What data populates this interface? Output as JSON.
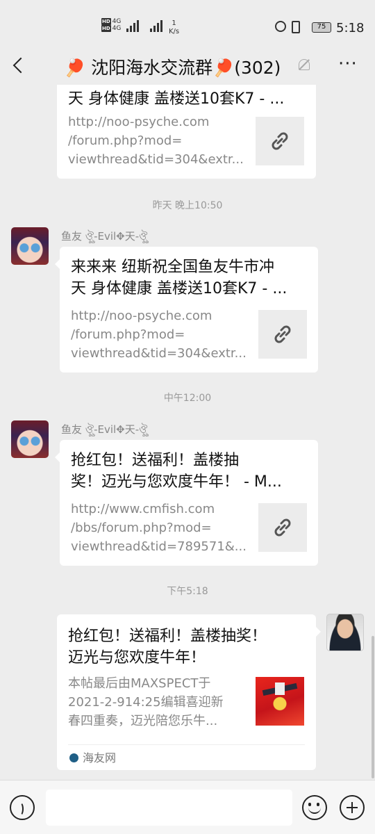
{
  "status_bar": {
    "network_badges": [
      "HD",
      "HD"
    ],
    "network_type": [
      "4G",
      "4G"
    ],
    "speed_value": "1",
    "speed_unit": "K/s",
    "battery": "75",
    "time": "5:18"
  },
  "header": {
    "title": "🏓 沈阳海水交流群🏓(302)",
    "more_label": "···"
  },
  "messages": [
    {
      "title": "天 身体健康 盖楼送10套K7 - ...",
      "url": "http://noo-psyche.com\n/forum.php?mod=\nviewthread&tid=304&extr..."
    },
    {
      "time": "昨天 晚上10:50",
      "sender": "鱼友 ঔৣ-Evil✥天-ঔৣ",
      "title": "来来来 纽斯祝全国鱼友牛市冲\n天 身体健康 盖楼送10套K7 - ...",
      "url": "http://noo-psyche.com\n/forum.php?mod=\nviewthread&tid=304&extr..."
    },
    {
      "time": "中午12:00",
      "sender": "鱼友 ঔৣ-Evil✥天-ঔৣ",
      "title": "抢红包！送福利！盖楼抽\n奖！迈光与您欢度牛年！ - M...",
      "url": "http://www.cmfish.com\n/bbs/forum.php?mod=\nviewthread&tid=789571&..."
    },
    {
      "time": "下午5:18",
      "title": "抢红包！送福利！盖楼抽奖！\n迈光与您欢度牛年！",
      "desc": "本帖最后由MAXSPECT于\n2021-2-914:25编辑喜迎新\n春四重奏，迈光陪您乐牛...",
      "source": "海友网"
    }
  ],
  "input": {
    "placeholder": ""
  }
}
